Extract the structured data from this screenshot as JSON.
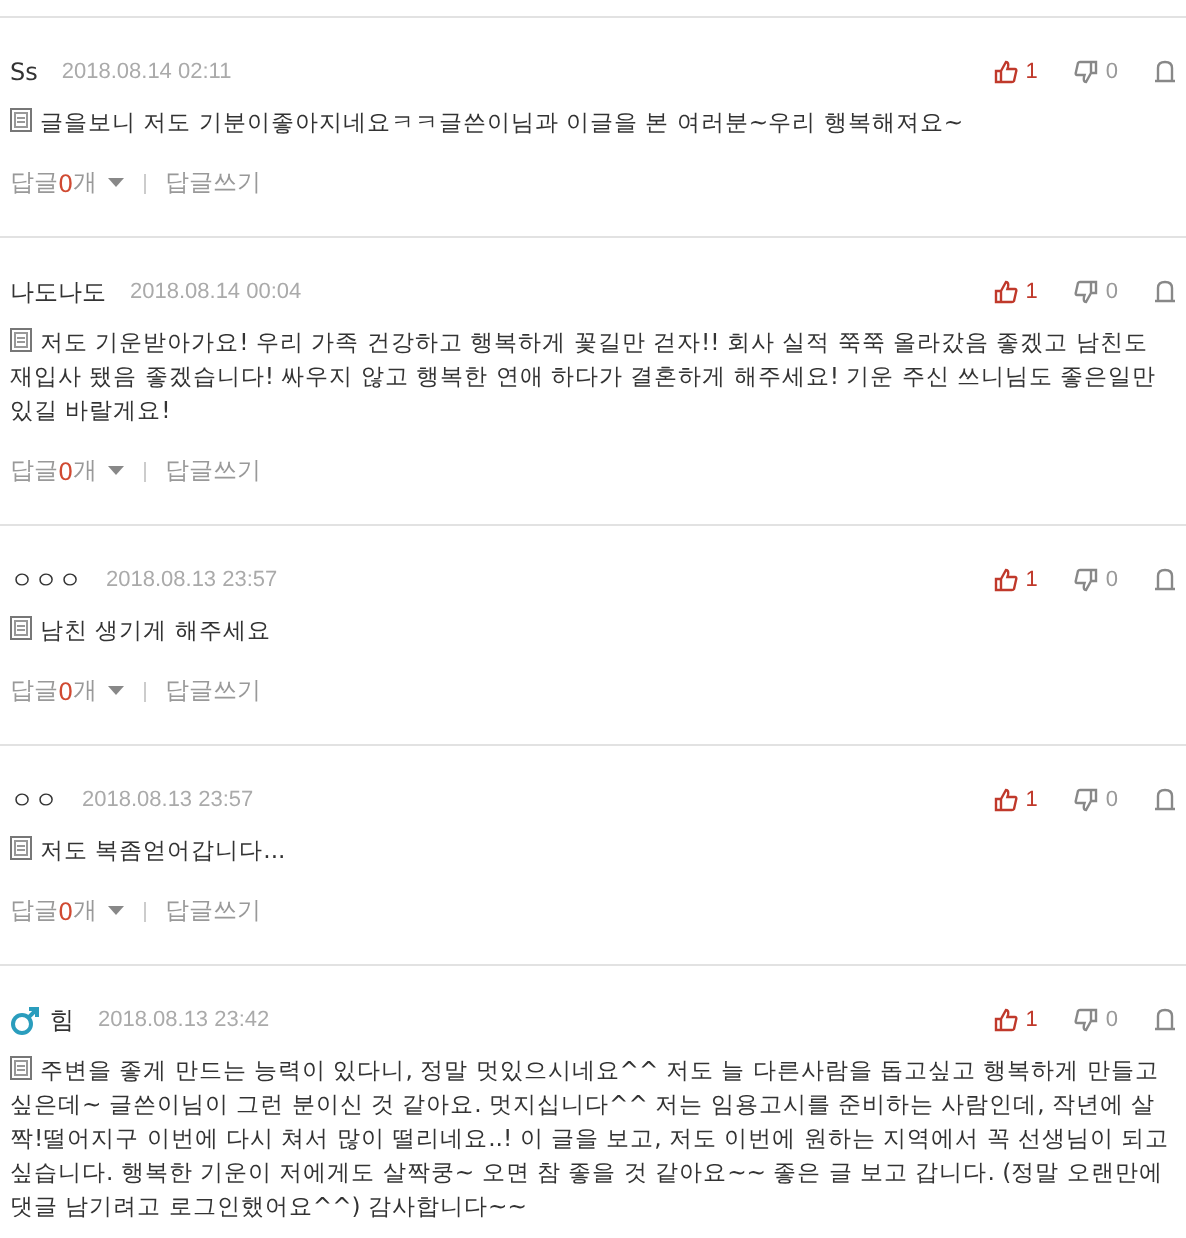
{
  "comments": [
    {
      "author": "Ss",
      "date": "2018.08.14 02:11",
      "likes": "1",
      "dislikes": "0",
      "text": "글을보니 저도 기분이좋아지네요ㅋㅋ글쓴이님과 이글을 본 여러분~우리 행복해져요~",
      "reply_label": "답글",
      "reply_count": "0",
      "reply_unit": "개",
      "write_reply": "답글쓰기"
    },
    {
      "author": "나도나도",
      "date": "2018.08.14 00:04",
      "likes": "1",
      "dislikes": "0",
      "text": "저도 기운받아가요! 우리 가족 건강하고 행복하게 꽃길만 걷자!! 회사 실적 쭉쭉 올라갔음 좋겠고 남친도 재입사 됐음 좋겠습니다! 싸우지 않고 행복한 연애 하다가 결혼하게 해주세요! 기운 주신 쓰니님도 좋은일만 있길 바랄게요!",
      "reply_label": "답글",
      "reply_count": "0",
      "reply_unit": "개",
      "write_reply": "답글쓰기"
    },
    {
      "author": "ㅇㅇㅇ",
      "date": "2018.08.13 23:57",
      "likes": "1",
      "dislikes": "0",
      "text": "남친 생기게 해주세요",
      "reply_label": "답글",
      "reply_count": "0",
      "reply_unit": "개",
      "write_reply": "답글쓰기"
    },
    {
      "author": "ㅇㅇ",
      "date": "2018.08.13 23:57",
      "likes": "1",
      "dislikes": "0",
      "text": "저도 복좀얻어갑니다...",
      "reply_label": "답글",
      "reply_count": "0",
      "reply_unit": "개",
      "write_reply": "답글쓰기"
    },
    {
      "author": "힘",
      "male": true,
      "date": "2018.08.13 23:42",
      "likes": "1",
      "dislikes": "0",
      "text": "주변을 좋게 만드는 능력이 있다니, 정말 멋있으시네요^^ 저도 늘 다른사람을 돕고싶고 행복하게 만들고 싶은데~ 글쓴이님이 그런 분이신 것 같아요. 멋지십니다^^ 저는 임용고시를 준비하는 사람인데, 작년에 살짝!떨어지구 이번에 다시 쳐서 많이 떨리네요..! 이 글을 보고, 저도 이번에 원하는 지역에서 꼭 선생님이 되고 싶습니다. 행복한 기운이 저에게도 살짝쿵~ 오면 참 좋을 것 같아요~~ 좋은 글 보고 갑니다. (정말 오랜만에 댓글 남기려고 로그인했어요^^) 감사합니다~~"
    }
  ]
}
